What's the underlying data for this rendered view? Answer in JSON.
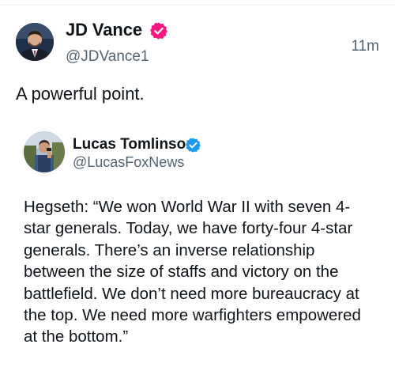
{
  "post": {
    "author": {
      "name": "JD Vance",
      "handle": "@JDVance1",
      "verified": true,
      "badge_color": "#f91880",
      "avatar_icon": "profile-photo-man-in-suit"
    },
    "timestamp": "11m",
    "text": "A powerful point."
  },
  "quoted_post": {
    "author": {
      "name": "Lucas Tomlinson",
      "handle": "@LucasFoxNews",
      "verified": true,
      "badge_color": "#1d9bf0",
      "avatar_icon": "profile-photo-man-outdoors"
    },
    "text": "Hegseth: “We won World War II with seven 4-\nstar generals. Today, we have forty-four 4-star\ngenerals. There’s an inverse relationship\nbetween the size of staffs and victory on the\nbattlefield. We don’t need more bureaucracy at\nthe top. We need more warfighters empowered\nat the bottom.”"
  }
}
